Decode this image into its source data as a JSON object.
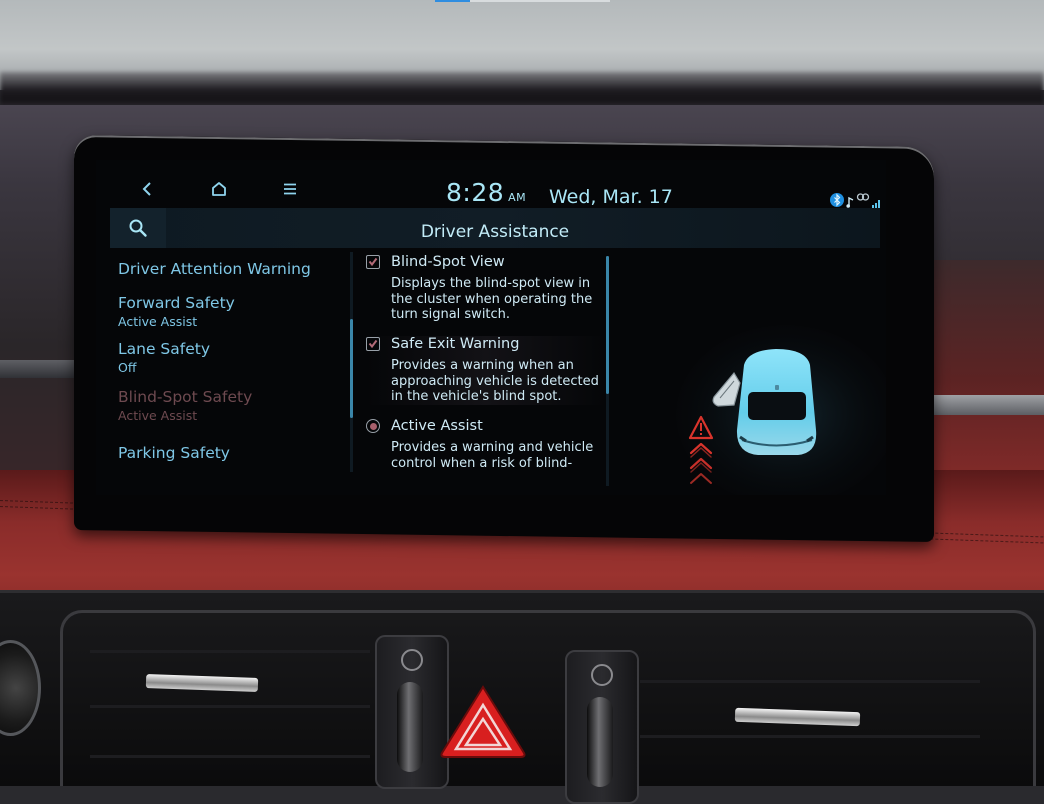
{
  "video_progress": {
    "fraction": 0.2
  },
  "head_unit": {
    "nav": {
      "back_icon": "back-chevron-icon",
      "home_icon": "home-icon",
      "menu_icon": "menu-icon"
    },
    "clock": {
      "time": "8:28",
      "ampm": "AM"
    },
    "date": "Wed, Mar. 17",
    "status_icons": [
      "bluetooth-icon",
      "music-note-icon",
      "connected-link-icon",
      "signal-strength-icon"
    ],
    "title": "Driver Assistance",
    "search_icon": "search-icon",
    "menu": [
      {
        "label": "Driver Attention Warning",
        "sub": ""
      },
      {
        "label": "Forward Safety",
        "sub": "Active Assist"
      },
      {
        "label": "Lane Safety",
        "sub": "Off"
      },
      {
        "label": "Blind-Spot Safety",
        "sub": "Active Assist",
        "selected": true
      },
      {
        "label": "Parking Safety",
        "sub": ""
      }
    ],
    "menu_scroll": {
      "position": 0.55,
      "visible_fraction": 0.45
    },
    "options": [
      {
        "type": "checkbox",
        "checked": true,
        "title": "Blind-Spot View",
        "description": "Displays the blind-spot view in the cluster when operating the turn signal switch."
      },
      {
        "type": "checkbox",
        "checked": true,
        "title": "Safe Exit Warning",
        "description": "Provides a warning when an approaching vehicle is detected in the vehicle's blind spot."
      },
      {
        "type": "radio",
        "selected": true,
        "title": "Active Assist",
        "description": "Provides a warning and vehicle control when a risk of blind-"
      }
    ],
    "options_scroll": {
      "position": 0.0,
      "visible_fraction": 0.6
    },
    "illustration": "safe-exit-warning-car-illustration",
    "colors": {
      "accent_text": "#7fc7e6",
      "clock_text": "#a9e6f6",
      "selected_dim": "#6e4a50",
      "warning_red": "#d8342c",
      "car_cyan": "#6fd6f2",
      "scroll_thumb": "#3a86a9"
    }
  },
  "dashboard": {
    "hazard_button": "hazard-warning-button",
    "vent_defrost_icons": [
      "seat-heat-icon",
      "seat-heat-icon"
    ]
  }
}
